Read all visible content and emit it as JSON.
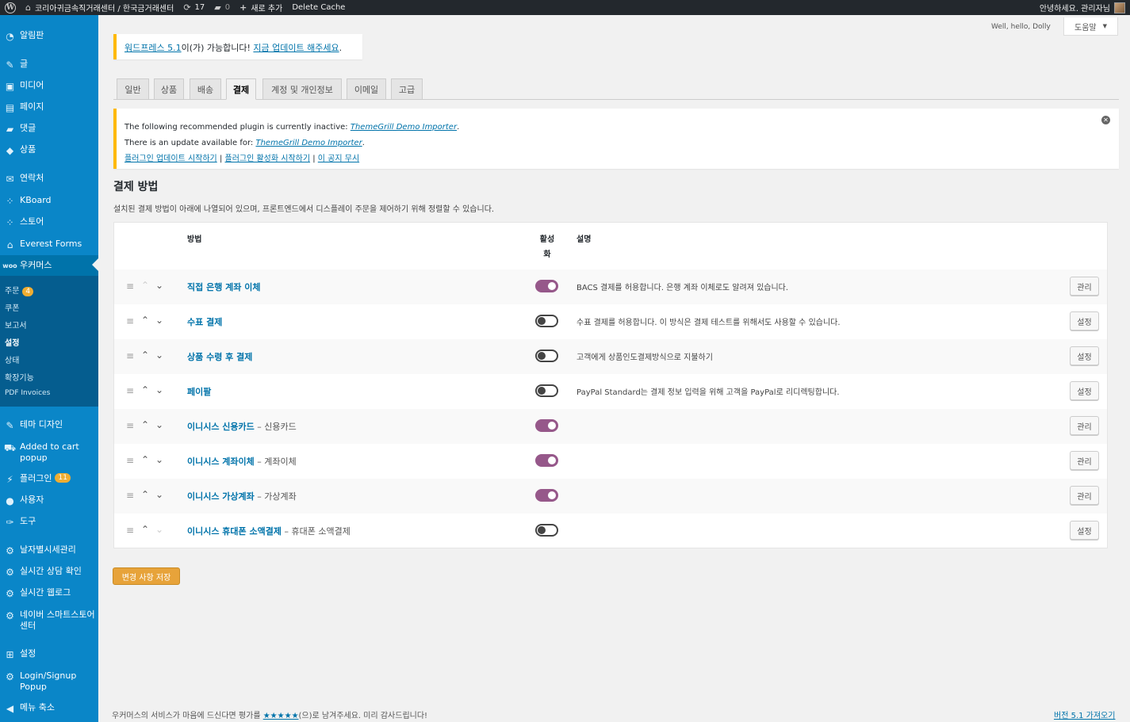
{
  "admin_bar": {
    "site_name": "코리아귀금속직거래센터 / 한국금거래센터",
    "updates_count": "17",
    "comments_count": "0",
    "new_label": "새로 추가",
    "delete_cache": "Delete Cache",
    "greeting": "안녕하세요. 관리자님"
  },
  "sidebar": {
    "items": [
      {
        "label": "알림판",
        "icon": "dashboard-icon"
      },
      {
        "label": "글",
        "icon": "pin-icon"
      },
      {
        "label": "미디어",
        "icon": "media-icon"
      },
      {
        "label": "페이지",
        "icon": "page-icon"
      },
      {
        "label": "댓글",
        "icon": "comment-icon"
      },
      {
        "label": "상품",
        "icon": "product-icon"
      },
      {
        "label": "연락처",
        "icon": "mail-icon"
      },
      {
        "label": "KBoard",
        "icon": "kboard-icon"
      },
      {
        "label": "스토어",
        "icon": "store-icon"
      },
      {
        "label": "Everest Forms",
        "icon": "forms-icon"
      },
      {
        "label": "우커머스",
        "icon": "woo-icon"
      },
      {
        "label": "테마 디자인",
        "icon": "brush-icon"
      },
      {
        "label": "Added to cart popup",
        "icon": "cart-icon"
      },
      {
        "label": "플러그인",
        "icon": "plugin-icon"
      },
      {
        "label": "사용자",
        "icon": "user-icon"
      },
      {
        "label": "도구",
        "icon": "wrench-icon"
      },
      {
        "label": "날자별시세관리",
        "icon": "gear-icon"
      },
      {
        "label": "실시간 상담 확인",
        "icon": "gear-icon"
      },
      {
        "label": "실시간 웹로그",
        "icon": "gear-icon"
      },
      {
        "label": "네이버 스마트스토어센터",
        "icon": "gear-icon"
      },
      {
        "label": "설정",
        "icon": "settings-icon"
      },
      {
        "label": "Login/Signup Popup",
        "icon": "gear-icon"
      },
      {
        "label": "메뉴 축소",
        "icon": "collapse-icon"
      }
    ],
    "plugins_badge": "11",
    "submenu": [
      {
        "label": "주문",
        "badge": "4"
      },
      {
        "label": "쿠폰"
      },
      {
        "label": "보고서"
      },
      {
        "label": "설정"
      },
      {
        "label": "상태"
      },
      {
        "label": "확장기능"
      },
      {
        "label": "PDF Invoices"
      }
    ]
  },
  "screen_meta": {
    "dolly": "Well, hello, Dolly",
    "help": "도움말"
  },
  "update_nag": {
    "link1": "워드프레스 5.1",
    "text": "이(가) 가능합니다! ",
    "link2": "지금 업데이트 해주세요",
    "end": "."
  },
  "tabs": [
    "일반",
    "상품",
    "배송",
    "결제",
    "계정 및 개인정보",
    "이메일",
    "고급"
  ],
  "plugin_notice": {
    "line1_text": "The following recommended plugin is currently inactive: ",
    "line2_text": "There is an update available for: ",
    "plugin_name": "ThemeGrill Demo Importer",
    "action1": "플러그인 업데이트 시작하기",
    "action2": "플러그인 활성화 시작하기",
    "action3": "이 공지 무시",
    "sep": " | "
  },
  "section": {
    "title": "결제 방법",
    "desc": "설치된 결제 방법이 아래에 나열되어 있으며, 프론트엔드에서 디스플레이 주문을 제어하기 위해 정렬할 수 있습니다."
  },
  "table": {
    "headers": {
      "method": "방법",
      "enabled": "활성화",
      "description": "설명"
    },
    "rows": [
      {
        "name": "직접 은행 계좌 이체",
        "sub": "",
        "enabled": true,
        "desc": "BACS 결제를 허용합니다. 은행 계좌 이체로도 알려져 있습니다.",
        "action": "관리"
      },
      {
        "name": "수표 결제",
        "sub": "",
        "enabled": false,
        "desc": "수표 결제를 허용합니다. 이 방식은 결제 테스트를 위해서도 사용할 수 있습니다.",
        "action": "설정"
      },
      {
        "name": "상품 수령 후 결제",
        "sub": "",
        "enabled": false,
        "desc": "고객에게 상품인도결제방식으로 지불하기",
        "action": "설정"
      },
      {
        "name": "페이팔",
        "sub": "",
        "enabled": false,
        "desc": "PayPal Standard는 결제 정보 입력을 위해 고객을 PayPal로 리디렉팅합니다.",
        "action": "설정"
      },
      {
        "name": "이니시스 신용카드",
        "sub": "신용카드",
        "enabled": true,
        "desc": "",
        "action": "관리"
      },
      {
        "name": "이니시스 계좌이체",
        "sub": "계좌이체",
        "enabled": true,
        "desc": "",
        "action": "관리"
      },
      {
        "name": "이니시스 가상계좌",
        "sub": "가상계좌",
        "enabled": true,
        "desc": "",
        "action": "관리"
      },
      {
        "name": "이니시스 휴대폰 소액결제",
        "sub": "휴대폰 소액결제",
        "enabled": false,
        "desc": "",
        "action": "설정"
      }
    ]
  },
  "save_button": "변경 사항 저장",
  "footer": {
    "left_before": "우커머스의 서비스가 마음에 드신다면 평가를 ",
    "stars": "★★★★★",
    "left_after": "(으)로 남겨주세요. 미리 감사드립니다!",
    "right": "버전 5.1 가져오기"
  }
}
